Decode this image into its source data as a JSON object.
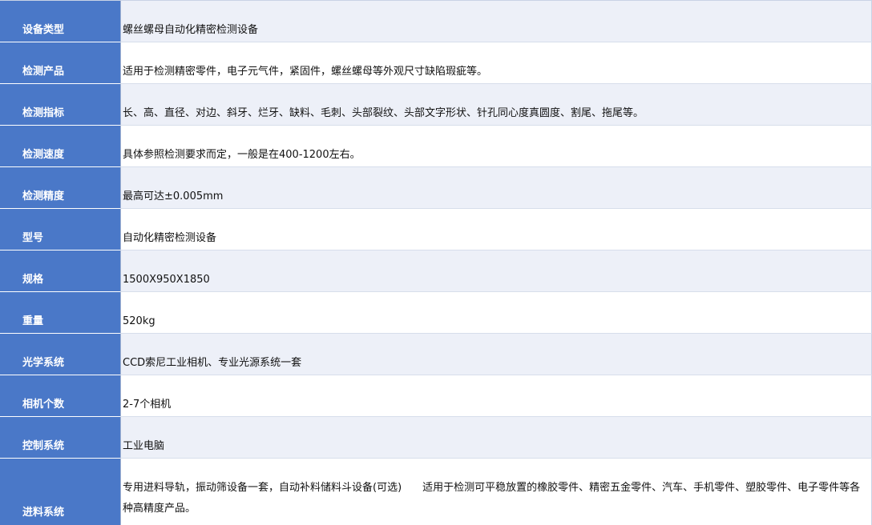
{
  "rows": [
    {
      "label": "设备类型",
      "value": "螺丝螺母自动化精密检测设备"
    },
    {
      "label": "检测产品",
      "value": "适用于检测精密零件，电子元气件，紧固件，螺丝螺母等外观尺寸缺陷瑕疵等。"
    },
    {
      "label": "检测指标",
      "value": "长、高、直径、对边、斜牙、烂牙、缺料、毛刺、头部裂纹、头部文字形状、针孔同心度真圆度、割尾、拖尾等。"
    },
    {
      "label": "检测速度",
      "value": "具体参照检测要求而定，一般是在400-1200左右。"
    },
    {
      "label": "检测精度",
      "value": "最高可达±0.005mm"
    },
    {
      "label": "型号",
      "value": "自动化精密检测设备"
    },
    {
      "label": "规格",
      "value": "1500X950X1850"
    },
    {
      "label": "重量",
      "value": "520kg"
    },
    {
      "label": "光学系统",
      "value": "CCD索尼工业相机、专业光源系统一套"
    },
    {
      "label": "相机个数",
      "value": "2-7个相机"
    },
    {
      "label": "控制系统",
      "value": "工业电脑"
    },
    {
      "label": "进料系统",
      "value": "专用进料导轨，振动筛设备一套，自动补料储料斗设备(可选)　　适用于检测可平稳放置的橡胶零件、精密五金零件、汽车、手机零件、塑胶零件、电子零件等各种高精度产品。"
    }
  ],
  "colors": {
    "label_bg": "#4a78c8",
    "label_text": "#ffffff",
    "shaded_row": "#edf0f8",
    "plain_row": "#ffffff"
  }
}
